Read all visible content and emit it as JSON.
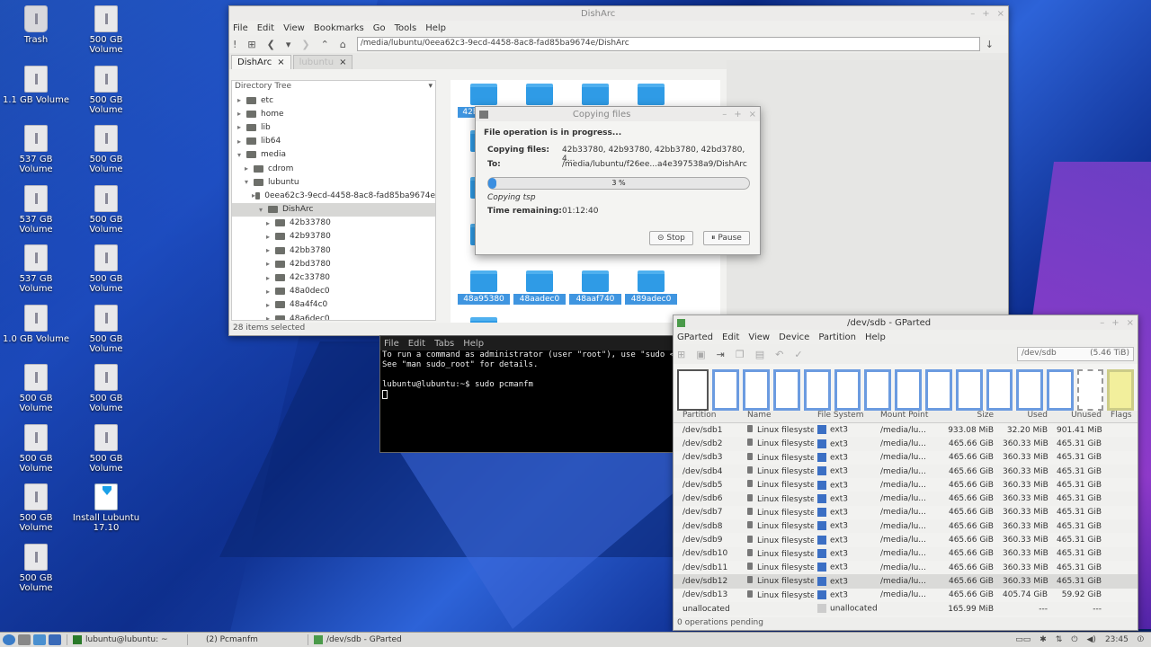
{
  "desktop": {
    "icons": [
      {
        "label": "Trash",
        "kind": "trash"
      },
      {
        "label": "500 GB Volume",
        "kind": "drive"
      },
      {
        "label": "1.1 GB Volume",
        "kind": "drive"
      },
      {
        "label": "500 GB Volume",
        "kind": "drive"
      },
      {
        "label": "537 GB Volume",
        "kind": "drive"
      },
      {
        "label": "500 GB Volume",
        "kind": "drive"
      },
      {
        "label": "537 GB Volume",
        "kind": "drive"
      },
      {
        "label": "500 GB Volume",
        "kind": "drive"
      },
      {
        "label": "537 GB Volume",
        "kind": "drive"
      },
      {
        "label": "500 GB Volume",
        "kind": "drive"
      },
      {
        "label": "1.0 GB Volume",
        "kind": "drive"
      },
      {
        "label": "500 GB Volume",
        "kind": "drive"
      },
      {
        "label": "500 GB Volume",
        "kind": "drive"
      },
      {
        "label": "500 GB Volume",
        "kind": "drive"
      },
      {
        "label": "500 GB Volume",
        "kind": "drive"
      },
      {
        "label": "500 GB Volume",
        "kind": "drive"
      },
      {
        "label": "500 GB Volume",
        "kind": "drive"
      },
      {
        "label": "Install Lubuntu 17.10",
        "kind": "installer"
      },
      {
        "label": "500 GB Volume",
        "kind": "drive"
      }
    ]
  },
  "pcmanfm": {
    "title": "DishArc",
    "menu": [
      "File",
      "Edit",
      "View",
      "Bookmarks",
      "Go",
      "Tools",
      "Help"
    ],
    "address": "/media/lubuntu/0eea62c3-9ecd-4458-8ac8-fad85ba9674e/DishArc",
    "tabs": [
      {
        "label": "DishArc"
      },
      {
        "label": "lubuntu"
      }
    ],
    "tree_header": "Directory Tree",
    "tree": [
      {
        "label": "etc",
        "depth": 0,
        "selected": false
      },
      {
        "label": "home",
        "depth": 0,
        "selected": false
      },
      {
        "label": "lib",
        "depth": 0,
        "selected": false
      },
      {
        "label": "lib64",
        "depth": 0,
        "selected": false
      },
      {
        "label": "media",
        "depth": 0,
        "selected": false
      },
      {
        "label": "cdrom",
        "depth": 1,
        "selected": false
      },
      {
        "label": "lubuntu",
        "depth": 1,
        "selected": false
      },
      {
        "label": "0eea62c3-9ecd-4458-8ac8-fad85ba9674e",
        "depth": 2,
        "selected": false
      },
      {
        "label": "DishArc",
        "depth": 3,
        "selected": true
      },
      {
        "label": "42b33780",
        "depth": 4,
        "selected": false
      },
      {
        "label": "42b93780",
        "depth": 4,
        "selected": false
      },
      {
        "label": "42bb3780",
        "depth": 4,
        "selected": false
      },
      {
        "label": "42bd3780",
        "depth": 4,
        "selected": false
      },
      {
        "label": "42c33780",
        "depth": 4,
        "selected": false
      },
      {
        "label": "48a0dec0",
        "depth": 4,
        "selected": false
      },
      {
        "label": "48a4f4c0",
        "depth": 4,
        "selected": false
      },
      {
        "label": "48a6dec0",
        "depth": 4,
        "selected": false
      }
    ],
    "files_top": [
      "42b",
      "",
      "",
      ""
    ],
    "files_bottom": [
      "48a95380",
      "48aadec0",
      "48aaf740",
      "489adec0"
    ],
    "status": "28 items selected"
  },
  "copy_dialog": {
    "title": "Copying files",
    "heading": "File operation is in progress...",
    "files_label": "Copying files:",
    "files_value": "42b33780, 42b93780, 42bb3780, 42bd3780, 4...",
    "to_label": "To:",
    "to_value": "/media/lubuntu/f26ee...a4e397538a9/DishArc",
    "progress_text": "3 %",
    "progress": 0.03,
    "current": "Copying tsp",
    "remaining_label": "Time remaining:",
    "remaining_value": "01:12:40",
    "stop": "Stop",
    "pause": "Pause"
  },
  "terminal": {
    "menu": [
      "File",
      "Edit",
      "Tabs",
      "Help"
    ],
    "lines": [
      "To run a command as administrator (user \"root\"), use \"sudo <co",
      "See \"man sudo_root\" for details.",
      "",
      "lubuntu@lubuntu:~$ sudo pcmanfm"
    ]
  },
  "gparted": {
    "title": "/dev/sdb - GParted",
    "menu": [
      "GParted",
      "Edit",
      "View",
      "Device",
      "Partition",
      "Help"
    ],
    "device": "/dev/sdb",
    "device_size": "(5.46 TiB)",
    "columns": [
      "Partition",
      "Name",
      "File System",
      "Mount Point",
      "Size",
      "Used",
      "Unused",
      "Flags"
    ],
    "rows": [
      {
        "partition": "/dev/sdb1",
        "name": "Linux filesystem",
        "fs": "ext3",
        "mount": "/media/lu...",
        "size": "933.08 MiB",
        "used": "32.20 MiB",
        "unused": "901.41 MiB"
      },
      {
        "partition": "/dev/sdb2",
        "name": "Linux filesystem",
        "fs": "ext3",
        "mount": "/media/lu...",
        "size": "465.66 GiB",
        "used": "360.33 MiB",
        "unused": "465.31 GiB"
      },
      {
        "partition": "/dev/sdb3",
        "name": "Linux filesystem",
        "fs": "ext3",
        "mount": "/media/lu...",
        "size": "465.66 GiB",
        "used": "360.33 MiB",
        "unused": "465.31 GiB"
      },
      {
        "partition": "/dev/sdb4",
        "name": "Linux filesystem",
        "fs": "ext3",
        "mount": "/media/lu...",
        "size": "465.66 GiB",
        "used": "360.33 MiB",
        "unused": "465.31 GiB"
      },
      {
        "partition": "/dev/sdb5",
        "name": "Linux filesystem",
        "fs": "ext3",
        "mount": "/media/lu...",
        "size": "465.66 GiB",
        "used": "360.33 MiB",
        "unused": "465.31 GiB"
      },
      {
        "partition": "/dev/sdb6",
        "name": "Linux filesystem",
        "fs": "ext3",
        "mount": "/media/lu...",
        "size": "465.66 GiB",
        "used": "360.33 MiB",
        "unused": "465.31 GiB"
      },
      {
        "partition": "/dev/sdb7",
        "name": "Linux filesystem",
        "fs": "ext3",
        "mount": "/media/lu...",
        "size": "465.66 GiB",
        "used": "360.33 MiB",
        "unused": "465.31 GiB"
      },
      {
        "partition": "/dev/sdb8",
        "name": "Linux filesystem",
        "fs": "ext3",
        "mount": "/media/lu...",
        "size": "465.66 GiB",
        "used": "360.33 MiB",
        "unused": "465.31 GiB"
      },
      {
        "partition": "/dev/sdb9",
        "name": "Linux filesystem",
        "fs": "ext3",
        "mount": "/media/lu...",
        "size": "465.66 GiB",
        "used": "360.33 MiB",
        "unused": "465.31 GiB"
      },
      {
        "partition": "/dev/sdb10",
        "name": "Linux filesystem",
        "fs": "ext3",
        "mount": "/media/lu...",
        "size": "465.66 GiB",
        "used": "360.33 MiB",
        "unused": "465.31 GiB"
      },
      {
        "partition": "/dev/sdb11",
        "name": "Linux filesystem",
        "fs": "ext3",
        "mount": "/media/lu...",
        "size": "465.66 GiB",
        "used": "360.33 MiB",
        "unused": "465.31 GiB"
      },
      {
        "partition": "/dev/sdb12",
        "name": "Linux filesystem",
        "fs": "ext3",
        "mount": "/media/lu...",
        "size": "465.66 GiB",
        "used": "360.33 MiB",
        "unused": "465.31 GiB"
      },
      {
        "partition": "/dev/sdb13",
        "name": "Linux filesystem",
        "fs": "ext3",
        "mount": "/media/lu...",
        "size": "465.66 GiB",
        "used": "405.74 GiB",
        "unused": "59.92 GiB"
      },
      {
        "partition": "unallocated",
        "name": "",
        "fs": "unallocated",
        "mount": "",
        "size": "165.99 MiB",
        "used": "---",
        "unused": "---"
      }
    ],
    "status": "0 operations pending"
  },
  "taskbar": {
    "tasks": [
      "lubuntu@lubuntu: ~",
      "(2) Pcmanfm",
      "/dev/sdb - GParted"
    ],
    "clock": "23:45"
  }
}
